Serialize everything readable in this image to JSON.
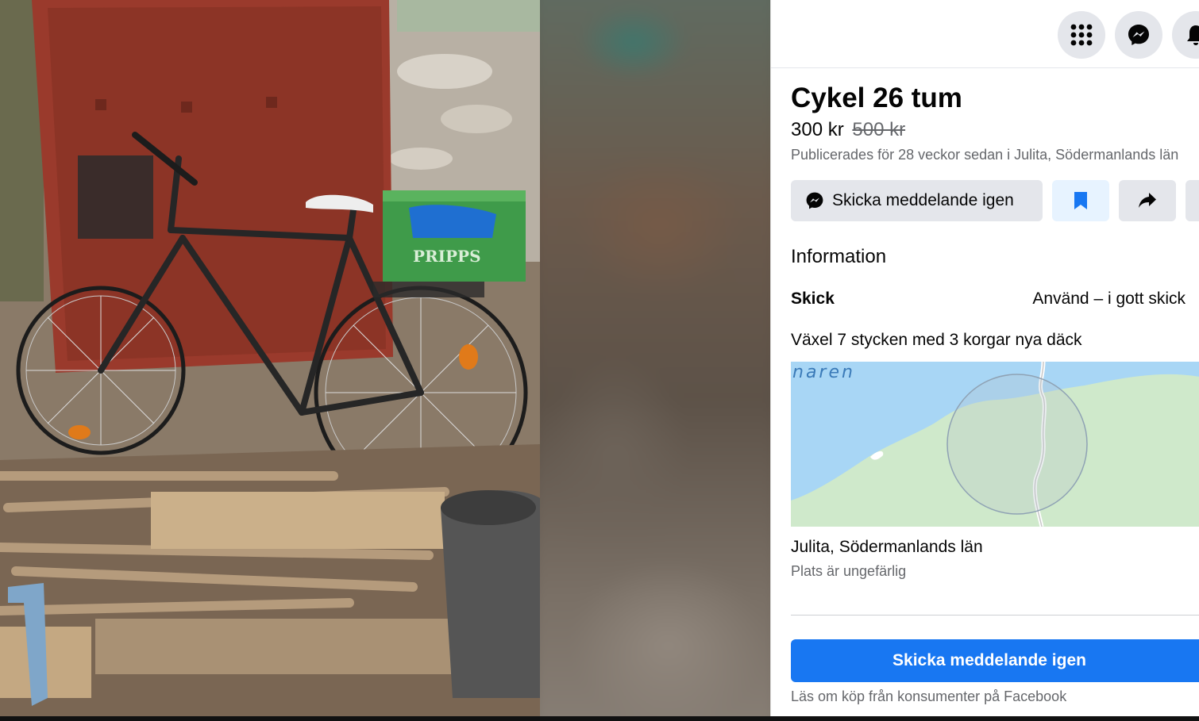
{
  "photo": {
    "alt_marker": "listing-photo",
    "crate_text": "PRIPPS"
  },
  "header": {
    "icons": [
      "apps-grid-icon",
      "messenger-icon",
      "notifications-icon"
    ]
  },
  "listing": {
    "title": "Cykel 26 tum",
    "price": "300 kr",
    "old_price": "500 kr",
    "published": "Publicerades för 28 veckor sedan i Julita, Södermanlands län"
  },
  "actions": {
    "message_label": "Skicka meddelande igen",
    "save_icon": "bookmark-icon",
    "share_icon": "share-icon"
  },
  "details": {
    "heading": "Information",
    "condition_label": "Skick",
    "condition_value": "Använd – i gott skick",
    "description": "Växel 7 stycken med 3 korgar nya däck"
  },
  "map": {
    "water_label": "naren"
  },
  "location": {
    "name": "Julita, Södermanlands län",
    "note": "Plats är ungefärlig"
  },
  "footer": {
    "primary_label": "Skicka meddelande igen",
    "buyer_link": "Läs om köp från konsumenter på Facebook"
  },
  "colors": {
    "accent": "#1877f2",
    "secondary_text": "#65676b",
    "button_gray": "#e4e6eb",
    "save_bg": "#e7f3ff"
  }
}
